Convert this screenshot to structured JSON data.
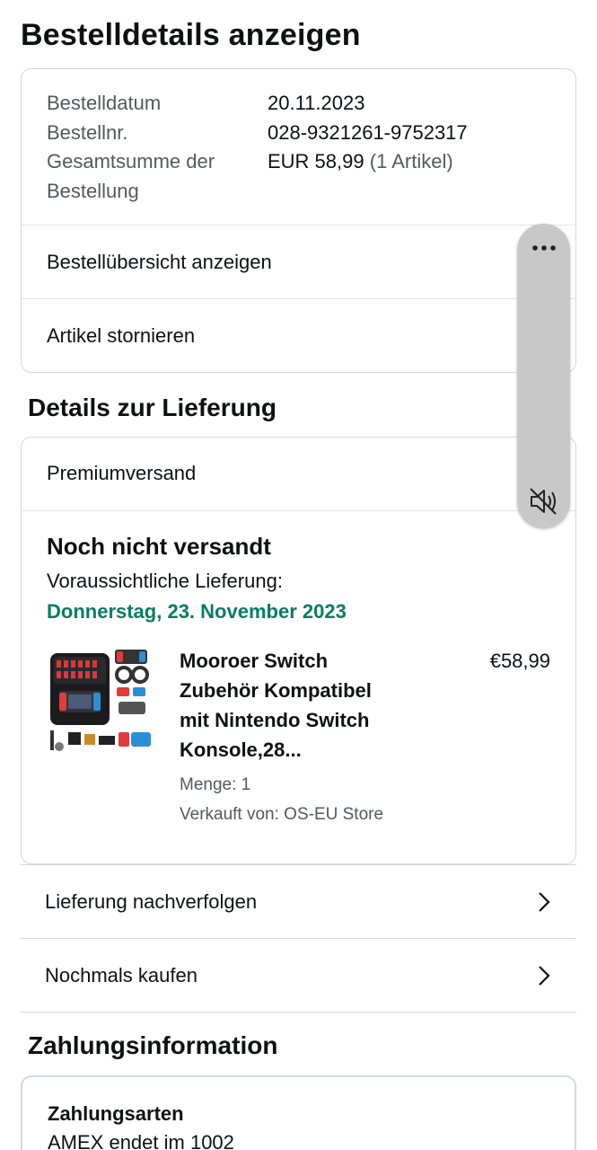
{
  "page": {
    "title": "Bestelldetails anzeigen"
  },
  "order_summary": {
    "labels": [
      "Bestelldatum",
      "Bestellnr.",
      "Gesamtsumme der",
      "Bestellung"
    ],
    "date": "20.11.2023",
    "number": "028-9321261-9752317",
    "total": "EUR 58,99",
    "item_count": "(1 Artikel)",
    "view_summary_label": "Bestellübersicht anzeigen",
    "cancel_label": "Artikel stornieren"
  },
  "delivery": {
    "section_title": "Details zur Lieferung",
    "shipping_method": "Premiumversand",
    "status": "Noch nicht versandt",
    "estimate_label": "Voraussichtliche Lieferung:",
    "estimate_date": "Donnerstag, 23. November 2023",
    "product": {
      "title_lines": [
        "Mooroer Switch",
        "Zubehör Kompatibel",
        "mit Nintendo Switch",
        "Konsole,28..."
      ],
      "price": "€58,99",
      "quantity": "Menge: 1",
      "seller": "Verkauft von: OS-EU Store"
    },
    "track_label": "Lieferung nachverfolgen",
    "rebuy_label": "Nochmals kaufen"
  },
  "payment": {
    "section_title": "Zahlungsinformation",
    "methods_label": "Zahlungsarten",
    "method_value": "AMEX  endet im 1002"
  },
  "overlay": {
    "icons": [
      "more-options-icon",
      "volume-muted-icon"
    ]
  },
  "colors": {
    "text": "#0f1111",
    "muted": "#565959",
    "delivery_date": "#067d62",
    "border": "#d5d9d9",
    "overlay_pill": "#c8c8c8"
  }
}
